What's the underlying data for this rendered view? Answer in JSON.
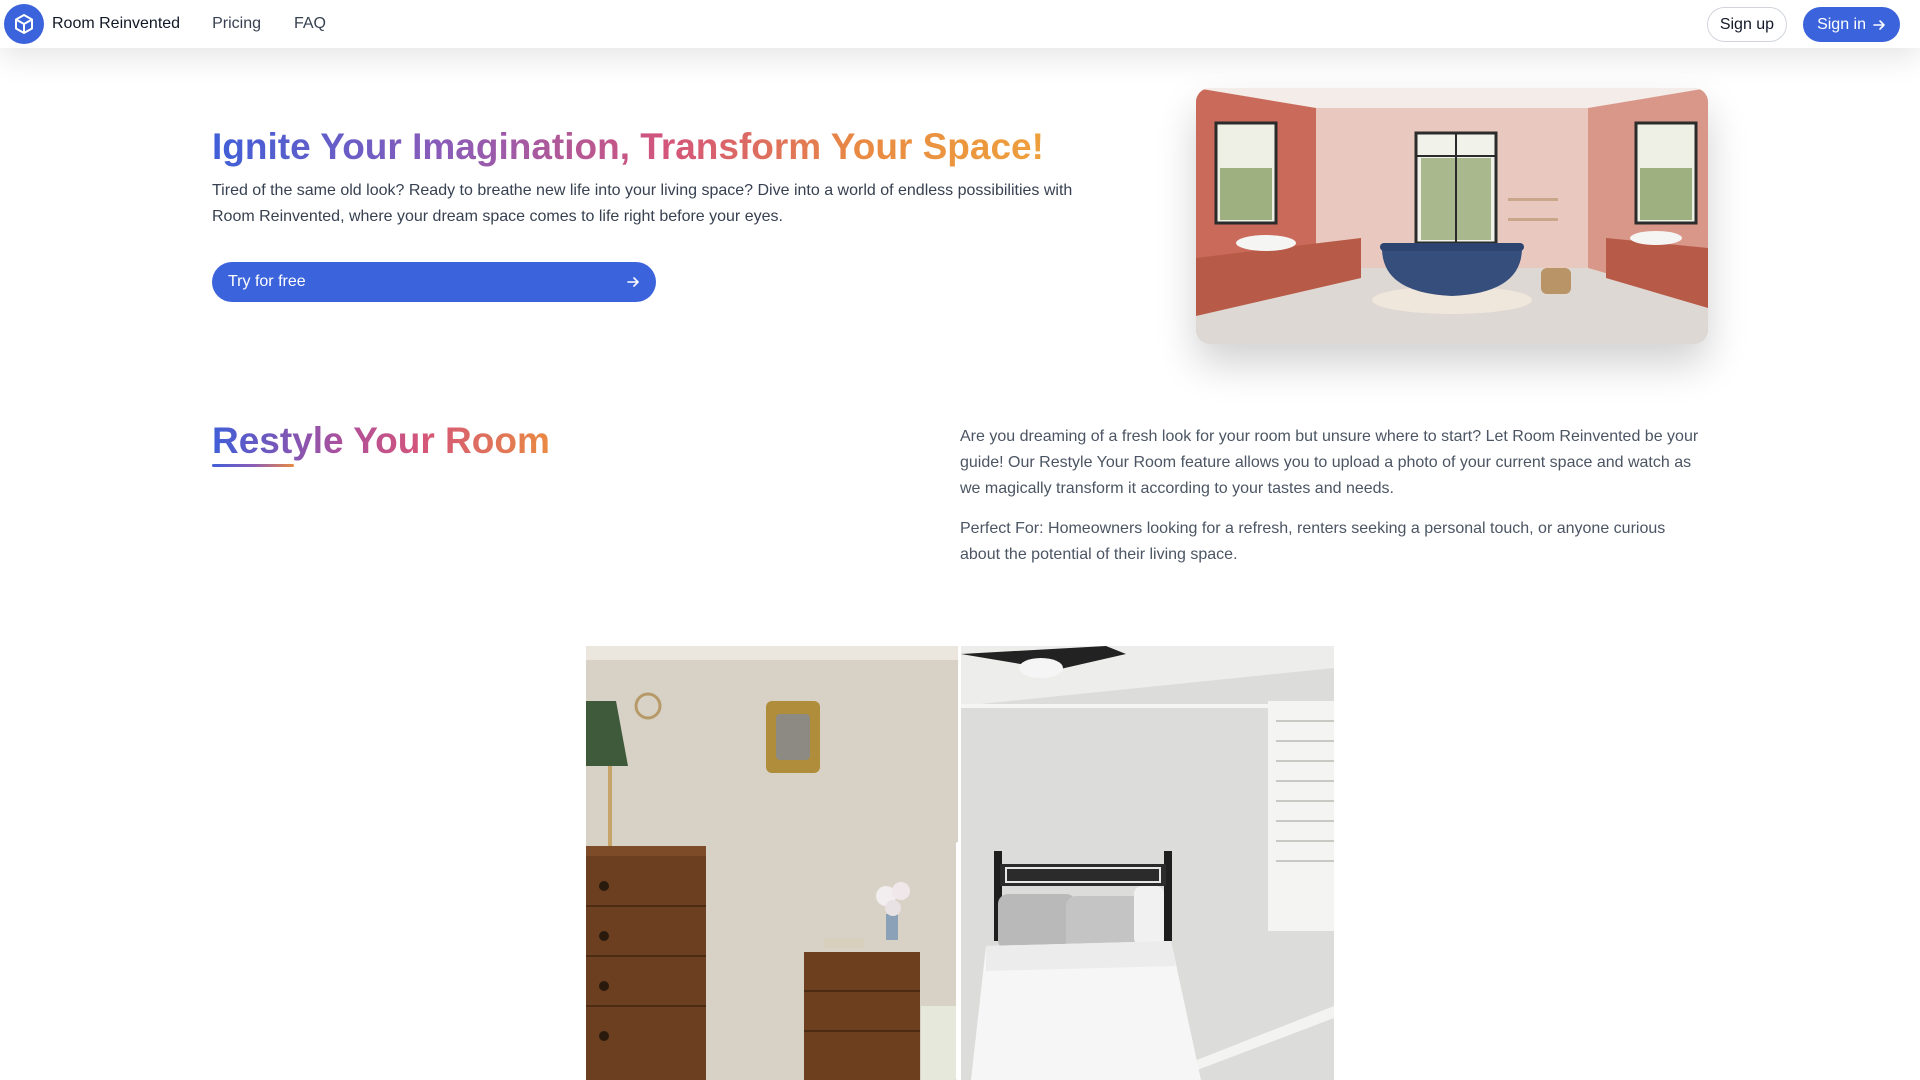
{
  "header": {
    "brand": "Room Reinvented",
    "nav": [
      "Pricing",
      "FAQ"
    ],
    "signup_label": "Sign up",
    "signin_label": "Sign in"
  },
  "hero": {
    "title": "Ignite Your Imagination, Transform Your Space!",
    "description": "Tired of the same old look? Ready to breathe new life into your living space? Dive into a world of endless possibilities with Room Reinvented, where your dream space comes to life right before your eyes.",
    "cta_label": "Try for free"
  },
  "restyle": {
    "title": "Restyle Your Room",
    "paragraph1": "Are you dreaming of a fresh look for your room but unsure where to start? Let Room Reinvented be your guide! Our Restyle Your Room feature allows you to upload a photo of your current space and watch as we magically transform it according to your tastes and needs.",
    "paragraph2": "Perfect For: Homeowners looking for a refresh, renters seeking a personal touch, or anyone curious about the potential of their living space."
  },
  "colors": {
    "primary": "#3b63db",
    "gradient_start": "#3f5fd8",
    "gradient_mid": "#d4557a",
    "gradient_end": "#eea03c"
  }
}
